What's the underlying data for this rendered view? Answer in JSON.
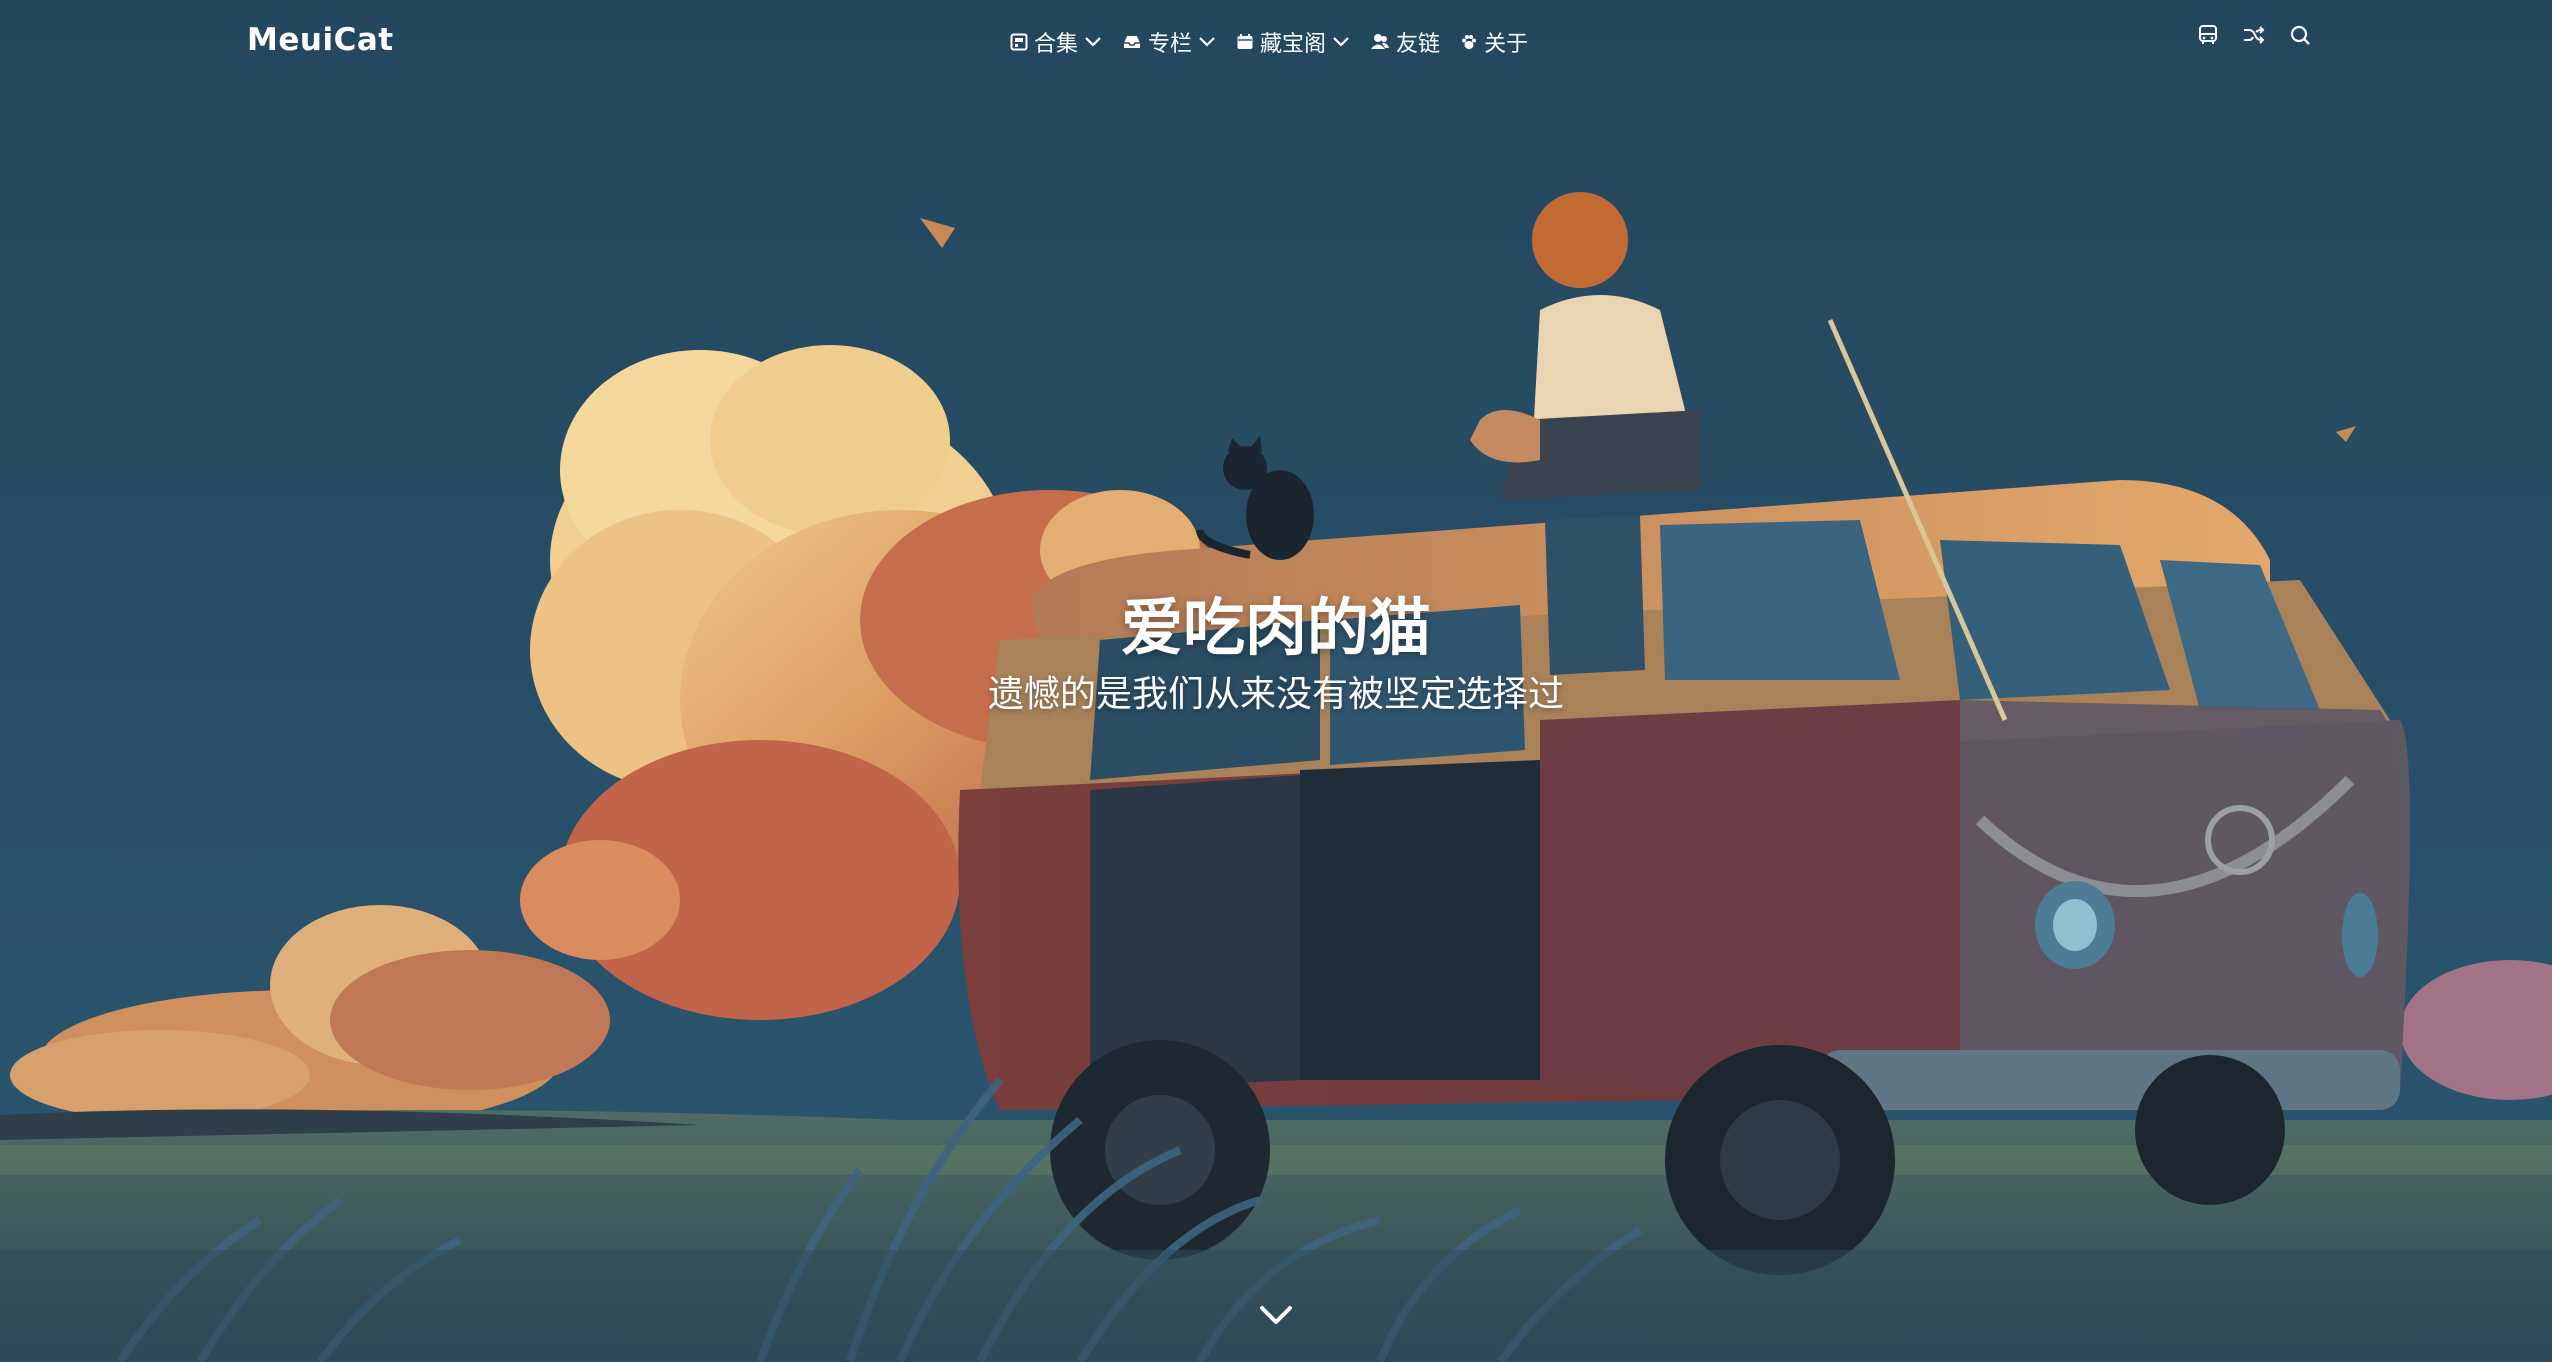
{
  "nav": {
    "brand": "MeuiCat",
    "menu": [
      {
        "label": "合集",
        "icon": "collection-icon",
        "dropdown": true
      },
      {
        "label": "专栏",
        "icon": "inbox-icon",
        "dropdown": true
      },
      {
        "label": "藏宝阁",
        "icon": "calendar-icon",
        "dropdown": true
      },
      {
        "label": "友链",
        "icon": "users-icon",
        "dropdown": false
      },
      {
        "label": "关于",
        "icon": "paw-icon",
        "dropdown": false
      }
    ],
    "tools": [
      {
        "icon": "bus-icon"
      },
      {
        "icon": "shuffle-icon"
      },
      {
        "icon": "search-icon"
      }
    ]
  },
  "hero": {
    "title": "爱吃肉的猫",
    "subtitle": "遗憾的是我们从来没有被坚定选择过",
    "scroll_icon": "chevron-down-icon"
  },
  "colors": {
    "sky": "#244b63",
    "text": "#ffffff",
    "van_body": "#6e3a3a",
    "van_roof": "#d9a060",
    "cloud_warm": "#e8b070"
  }
}
